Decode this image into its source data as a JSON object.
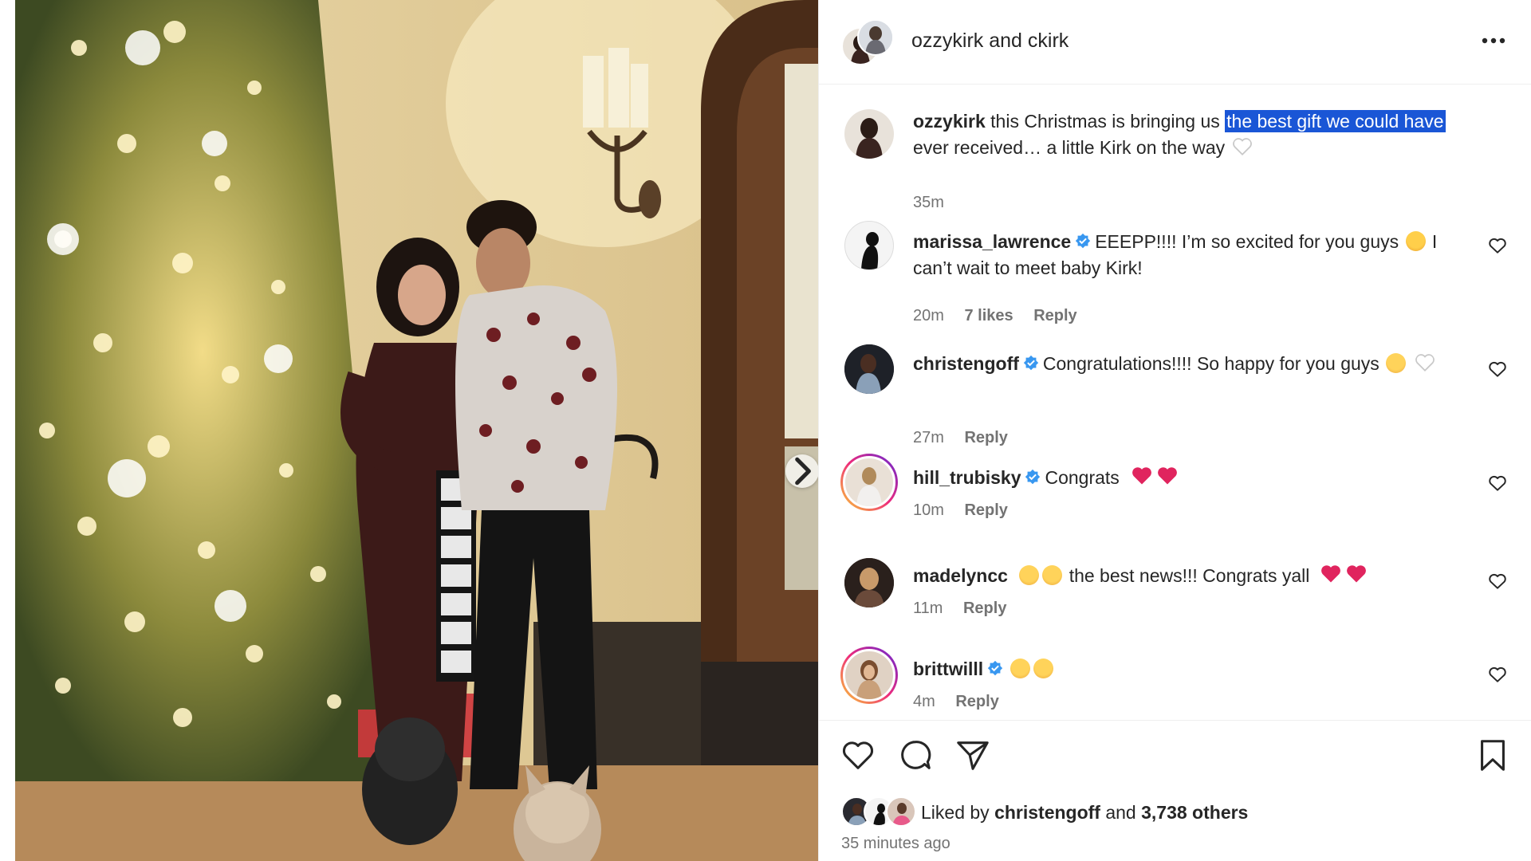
{
  "post": {
    "header_title": "ozzykirk and ckirk",
    "caption": {
      "username": "ozzykirk",
      "text_before": "this Christmas is bringing us ",
      "text_highlighted": "the best gift we could have",
      "text_after": " ever received… a little Kirk on the way",
      "time": "35m"
    }
  },
  "comments": [
    {
      "username": "marissa_lawrence",
      "verified": true,
      "text": "EEEPP!!!! I’m so excited for you guys",
      "text2": " I can’t wait to meet baby Kirk!",
      "time": "20m",
      "likes": "7 likes",
      "reply": "Reply"
    },
    {
      "username": "christengoff",
      "verified": true,
      "text": "Congratulations!!!! So happy for you guys",
      "time": "27m",
      "reply": "Reply"
    },
    {
      "username": "hill_trubisky",
      "verified": true,
      "text": "Congrats",
      "time": "10m",
      "reply": "Reply"
    },
    {
      "username": "madelyncc",
      "verified": false,
      "text": "the best news!!! Congrats yall",
      "time": "11m",
      "reply": "Reply"
    },
    {
      "username": "brittwilll",
      "verified": true,
      "text": "",
      "time": "4m",
      "reply": "Reply"
    }
  ],
  "footer": {
    "liked_prefix": "Liked by ",
    "liked_user": "christengoff",
    "liked_mid": " and ",
    "liked_count": "3,738 others",
    "posted_ago": "35 minutes ago"
  },
  "icons": {
    "more": "more-horizontal-icon",
    "like": "heart-icon",
    "comment": "comment-bubble-icon",
    "share": "paper-plane-icon",
    "save": "bookmark-icon",
    "next": "chevron-right-icon",
    "verified": "verified-badge-icon"
  },
  "colors": {
    "verified": "#3897f0",
    "highlight": "#1a56d6",
    "red_heart": "#e0245e",
    "meta_text": "#737373"
  }
}
